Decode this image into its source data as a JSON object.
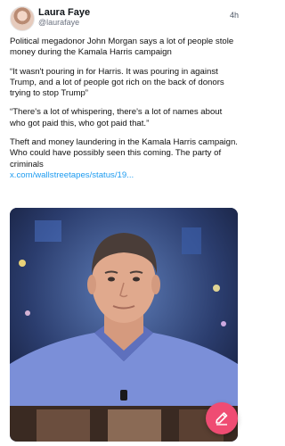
{
  "post": {
    "author_name": "Laura Faye",
    "author_handle": "@laurafaye",
    "timestamp": "4h",
    "paragraphs": [
      "Political megadonor John Morgan says a lot of people stole money during the Kamala Harris campaign",
      "“It wasn't pouring in for Harris. It was pouring in against Trump, and a lot of people got rich on the back of donors trying to stop Trump”",
      "“There's a lot of whispering, there's a lot of names about who got paid this, who got paid that.”",
      "Theft and money laundering in the Kamala Harris campaign. Who could have possibly seen this coming. The party of criminals"
    ],
    "link_text": "x.com/wallstreetapes/status/19..."
  },
  "icons": {
    "fab": "edit-icon"
  },
  "colors": {
    "link": "#1d9bf0",
    "fab": "#ef4c73"
  }
}
